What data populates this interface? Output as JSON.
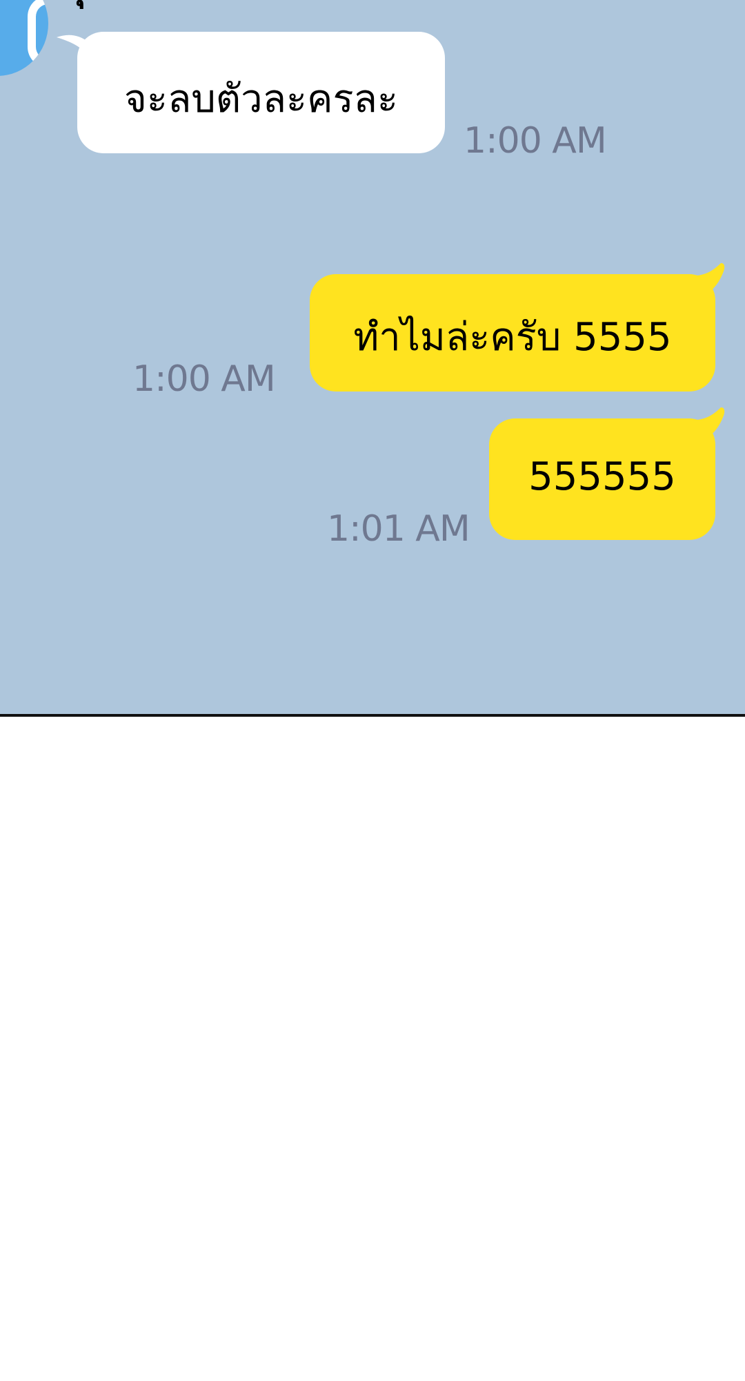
{
  "chat": {
    "sender_name": "คุณเจ้าของ",
    "messages": [
      {
        "direction": "incoming",
        "text": "จะลบตัวละครละ",
        "time": "1:00 AM"
      },
      {
        "direction": "outgoing",
        "text": "ทำไมล่ะครับ 5555",
        "time": "1:00 AM"
      },
      {
        "direction": "outgoing",
        "text": "555555",
        "time": "1:01 AM"
      }
    ]
  },
  "colors": {
    "chat_background": "#aec6dc",
    "incoming_bubble": "#ffffff",
    "outgoing_bubble": "#ffe31f",
    "timestamp": "#6f7890",
    "avatar": "#57acea"
  },
  "icons": {
    "avatar": "profile-avatar-icon"
  }
}
